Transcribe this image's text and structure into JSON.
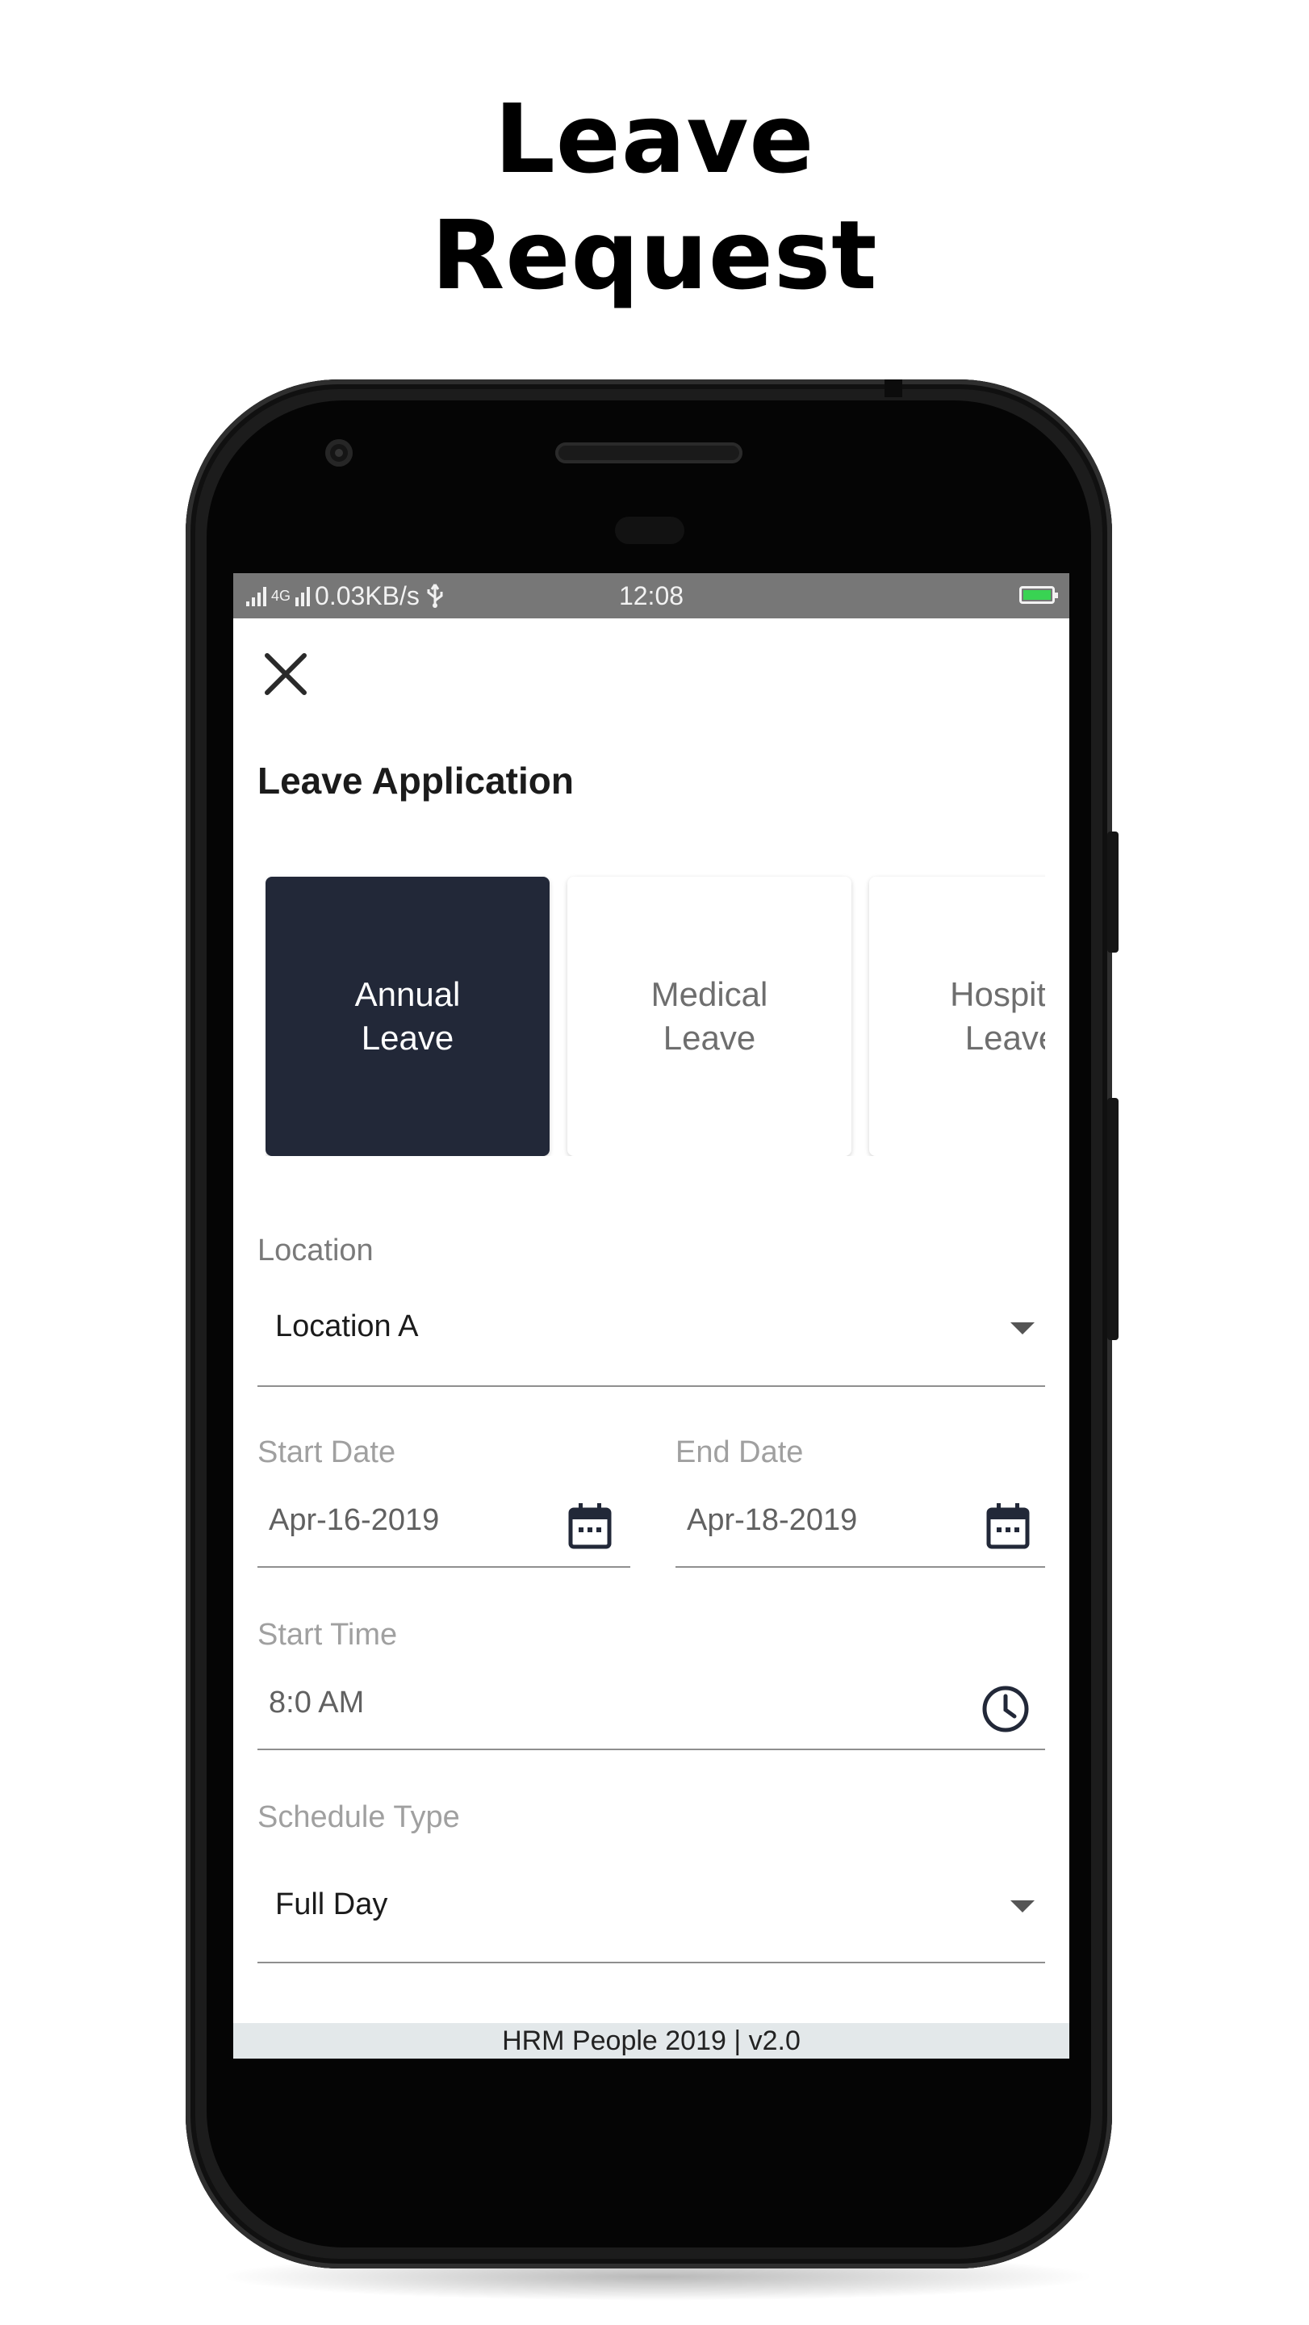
{
  "promo": {
    "title_line1": "Leave",
    "title_line2": "Request"
  },
  "status_bar": {
    "network": "4G",
    "speed": "0.03KB/s",
    "time": "12:08"
  },
  "page": {
    "title": "Leave Application"
  },
  "leave_types": [
    {
      "label": "Annual\nLeave",
      "selected": true
    },
    {
      "label": "Medical\nLeave",
      "selected": false
    },
    {
      "label": "Hospital\nLeave",
      "selected": false
    }
  ],
  "form": {
    "location": {
      "label": "Location",
      "value": "Location A"
    },
    "start_date": {
      "label": "Start Date",
      "value": "Apr-16-2019"
    },
    "end_date": {
      "label": "End Date",
      "value": "Apr-18-2019"
    },
    "start_time": {
      "label": "Start Time",
      "value": "8:0 AM"
    },
    "schedule_type": {
      "label": "Schedule Type",
      "value": "Full Day"
    }
  },
  "footer": {
    "text": "HRM People 2019 | v2.0"
  },
  "colors": {
    "selected_card": "#222838",
    "status_bar": "#777777",
    "footer_bg": "#e3e8ea"
  },
  "icons": [
    "signal-icon",
    "usb-icon",
    "battery-icon",
    "close-icon",
    "calendar-icon",
    "clock-icon",
    "dropdown-arrow-icon"
  ]
}
